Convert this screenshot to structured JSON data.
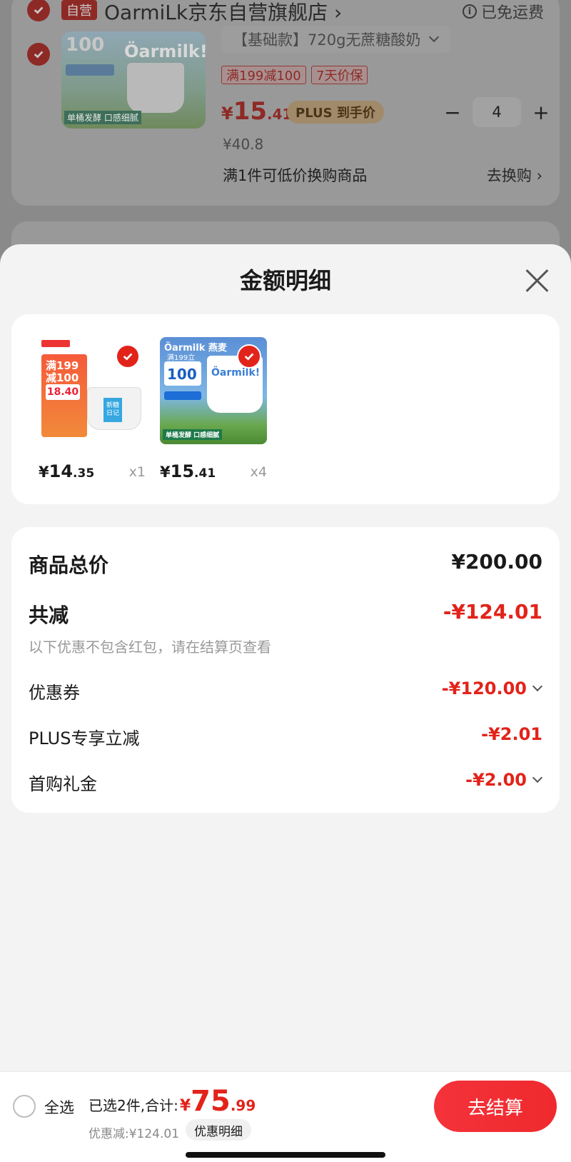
{
  "background_cart": {
    "self_operated_tag": "自营",
    "store_name": "OarmiLk京东自营旗舰店 ›",
    "free_shipping": "已免运费",
    "product_thumb": {
      "badge_value": "100",
      "brand": "Öarmilk!",
      "footer_text": "单桶发酵 口感细腻"
    },
    "spec": "【基础款】720g无蔗糖酸奶",
    "promo_tags": [
      "满199减100",
      "7天价保"
    ],
    "price": {
      "currency": "¥",
      "integer": "15",
      "decimal": ".41"
    },
    "plus_tag": "PLUS 到手价",
    "quantity": "4",
    "minus": "−",
    "plus": "+",
    "original_price": "¥40.8",
    "swap_text": "满1件可低价换购商品",
    "swap_link": "去换购 ›"
  },
  "sheet": {
    "title": "金额明细",
    "goods": [
      {
        "price_currency": "¥",
        "price_integer": "14",
        "price_decimal": ".35",
        "qty": "x1",
        "img": {
          "promo": "满199 减100",
          "price_tag": "18.40",
          "label": "新糖 日记"
        }
      },
      {
        "price_currency": "¥",
        "price_integer": "15",
        "price_decimal": ".41",
        "qty": "x4",
        "img": {
          "brand": "Öarmilk 燕麦",
          "badge": "满199立减",
          "badge_value": "100",
          "cup_text": "Öarmilk!",
          "footer": "单桶发酵 口感细腻"
        }
      }
    ],
    "total_label": "商品总价",
    "total_value": "¥200.00",
    "reduction_label": "共减",
    "reduction_value": "-¥124.01",
    "reduction_note": "以下优惠不包含红包，请在结算页查看",
    "items": [
      {
        "label": "优惠券",
        "value": "-¥120.00",
        "expandable": true
      },
      {
        "label": "PLUS专享立减",
        "value": "-¥2.01",
        "expandable": false
      },
      {
        "label": "首购礼金",
        "value": "-¥2.00",
        "expandable": true
      }
    ]
  },
  "bottom_bar": {
    "select_all": "全选",
    "summary_prefix": "已选2件,合计:",
    "total_currency": "¥",
    "total_integer": "75",
    "total_decimal": ".99",
    "discount": "优惠减:¥124.01",
    "detail_chip": "优惠明细",
    "checkout": "去结算"
  },
  "colors": {
    "accent": "#e2231a",
    "overlay": "#8c8c8c",
    "sheet_bg": "#f3f3f3"
  }
}
